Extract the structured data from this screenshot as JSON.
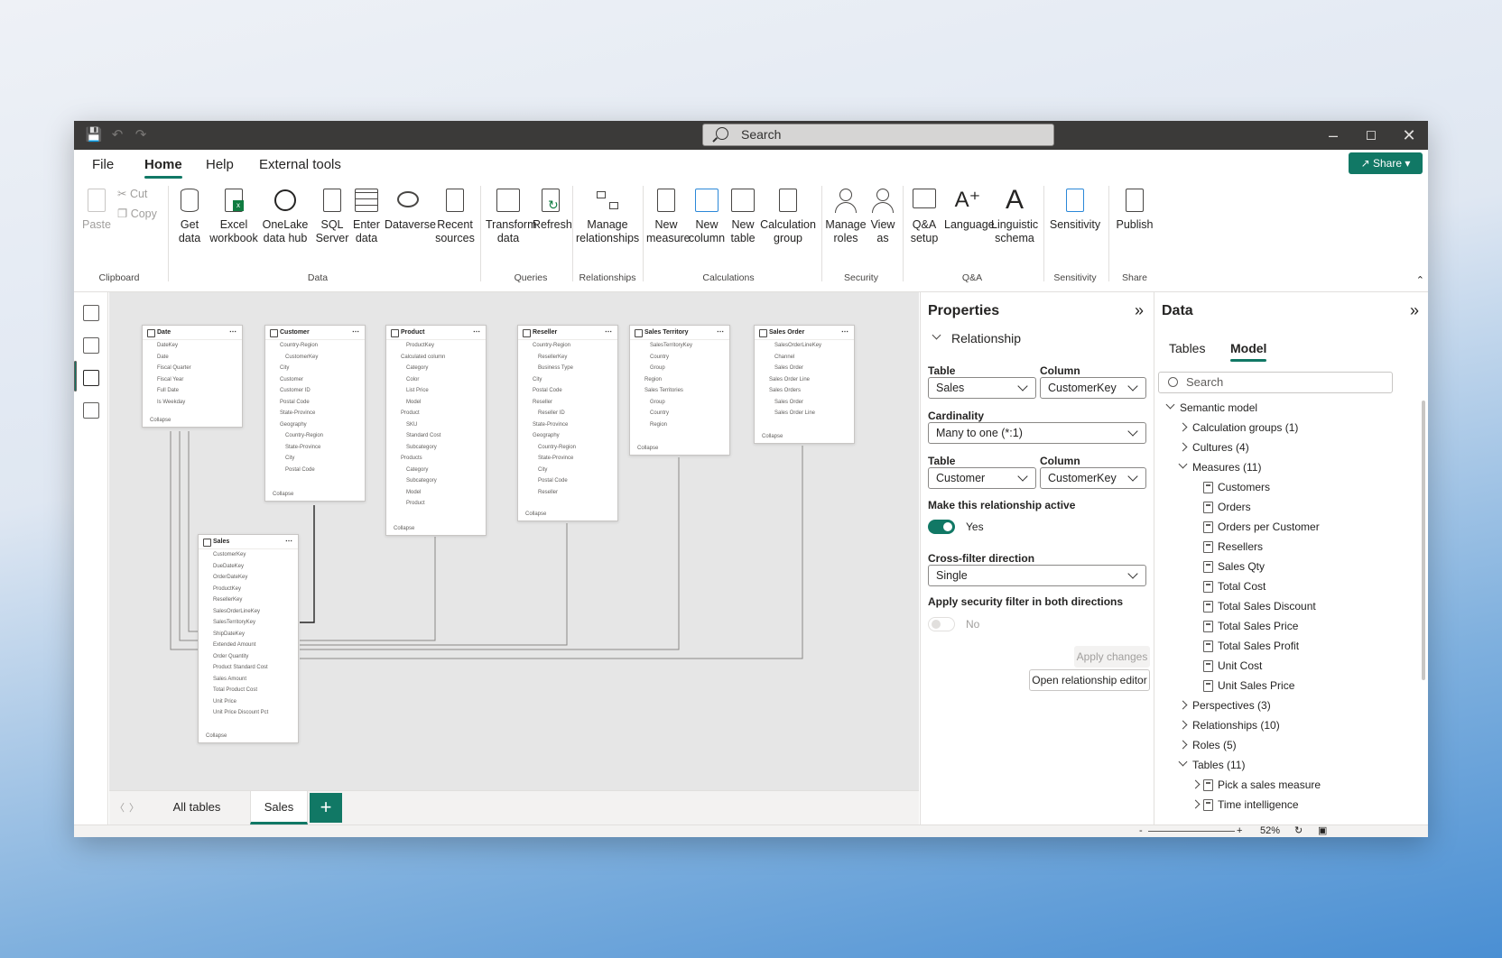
{
  "titlebar": {
    "search_placeholder": "Search"
  },
  "menu": {
    "items": [
      "File",
      "Home",
      "Help",
      "External tools"
    ],
    "share_label": "Share"
  },
  "ribbon": {
    "clipboard": {
      "paste": "Paste",
      "cut": "Cut",
      "copy": "Copy",
      "group": "Clipboard"
    },
    "data": {
      "get_data": "Get data",
      "excel": "Excel workbook",
      "onelake": "OneLake data hub",
      "sql": "SQL Server",
      "enter": "Enter data",
      "dataverse": "Dataverse",
      "recent": "Recent sources",
      "group": "Data"
    },
    "queries": {
      "transform": "Transform data",
      "refresh": "Refresh",
      "group": "Queries"
    },
    "relationships": {
      "manage": "Manage relationships",
      "group": "Relationships"
    },
    "calculations": {
      "new_measure": "New measure",
      "new_column": "New column",
      "new_table": "New table",
      "calc_group": "Calculation group",
      "group": "Calculations"
    },
    "security": {
      "manage_roles": "Manage roles",
      "view_as": "View as",
      "group": "Security"
    },
    "qa": {
      "qa_setup": "Q&A setup",
      "language": "Language",
      "linguistic": "Linguistic schema",
      "group": "Q&A"
    },
    "sensitivity": {
      "label": "Sensitivity",
      "group": "Sensitivity"
    },
    "share": {
      "publish": "Publish",
      "group": "Share"
    }
  },
  "model": {
    "tables": [
      {
        "name": "Date",
        "rows": [
          "DateKey",
          "Date",
          "Fiscal Quarter",
          "Fiscal Year",
          "Full Date",
          "Is Weekday"
        ]
      },
      {
        "name": "Customer",
        "rows": [
          "Country-Region",
          "CustomerKey",
          "City",
          "Customer",
          "Customer ID",
          "Postal Code",
          "State-Province",
          "Geography",
          "Country-Region",
          "State-Province",
          "City",
          "Postal Code"
        ]
      },
      {
        "name": "Product",
        "rows": [
          "ProductKey",
          "Calculated column",
          "Category",
          "Color",
          "List Price",
          "Model",
          "Product",
          "SKU",
          "Standard Cost",
          "Subcategory",
          "Products",
          "Category",
          "Subcategory",
          "Model",
          "Product"
        ]
      },
      {
        "name": "Reseller",
        "rows": [
          "Country-Region",
          "ResellerKey",
          "Business Type",
          "City",
          "Postal Code",
          "Reseller",
          "Reseller ID",
          "State-Province",
          "Geography",
          "Country-Region",
          "State-Province",
          "City",
          "Postal Code",
          "Reseller"
        ]
      },
      {
        "name": "Sales Territory",
        "rows": [
          "SalesTerritoryKey",
          "Country",
          "Group",
          "Region",
          "Sales Territories",
          "Group",
          "Country",
          "Region"
        ]
      },
      {
        "name": "Sales Order",
        "rows": [
          "SalesOrderLineKey",
          "Channel",
          "Sales Order",
          "Sales Order Line",
          "Sales Orders",
          "Sales Order",
          "Sales Order Line"
        ]
      },
      {
        "name": "Sales",
        "rows": [
          "CustomerKey",
          "DueDateKey",
          "OrderDateKey",
          "ProductKey",
          "ResellerKey",
          "SalesOrderLineKey",
          "SalesTerritoryKey",
          "ShipDateKey",
          "Extended Amount",
          "Order Quantity",
          "Product Standard Cost",
          "Sales Amount",
          "Total Product Cost",
          "Unit Price",
          "Unit Price Discount Pct"
        ]
      }
    ],
    "collapse_label": "Collapse",
    "tabs": [
      "All tables",
      "Sales"
    ],
    "add_tab": "+"
  },
  "properties": {
    "title": "Properties",
    "section": "Relationship",
    "table_label": "Table",
    "column_label": "Column",
    "table1": "Sales",
    "column1": "CustomerKey",
    "cardinality_label": "Cardinality",
    "cardinality": "Many to one (*:1)",
    "table2": "Customer",
    "column2": "CustomerKey",
    "active_label": "Make this relationship active",
    "active_value": "Yes",
    "crossfilter_label": "Cross-filter direction",
    "crossfilter": "Single",
    "security_label": "Apply security filter in both directions",
    "security_value": "No",
    "apply_btn": "Apply changes",
    "open_editor_btn": "Open relationship editor"
  },
  "datapane": {
    "title": "Data",
    "tabs": [
      "Tables",
      "Model"
    ],
    "search_placeholder": "Search",
    "tree": {
      "root": "Semantic model",
      "calc_groups": "Calculation groups (1)",
      "cultures": "Cultures (4)",
      "measures": "Measures (11)",
      "measure_items": [
        "Customers",
        "Orders",
        "Orders per Customer",
        "Resellers",
        "Sales Qty",
        "Total Cost",
        "Total Sales Discount",
        "Total Sales Price",
        "Total Sales Profit",
        "Unit Cost",
        "Unit Sales Price"
      ],
      "perspectives": "Perspectives (3)",
      "relationships": "Relationships (10)",
      "roles": "Roles (5)",
      "tables": "Tables (11)",
      "table_items": [
        "Pick a sales measure",
        "Time intelligence"
      ]
    }
  },
  "status": {
    "zoom_minus": "-",
    "zoom_plus": "+",
    "zoom": "52%"
  },
  "colors": {
    "accent": "#117865",
    "titlebar": "#3b3a39"
  }
}
